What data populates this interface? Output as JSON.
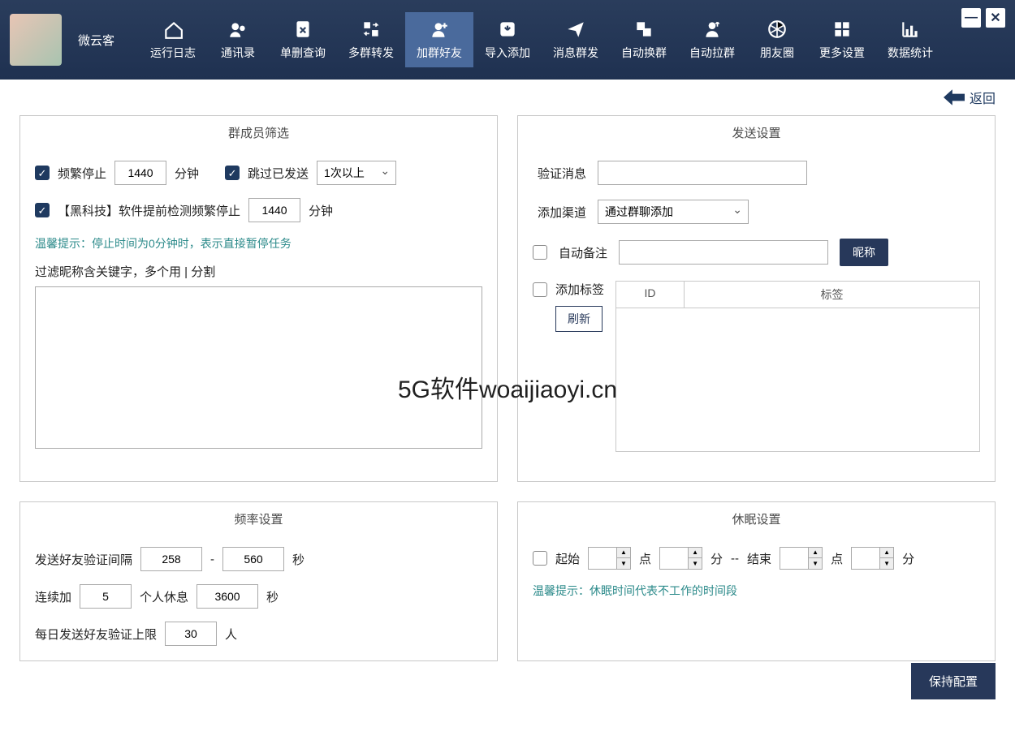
{
  "app_title": "微云客",
  "nav": [
    {
      "label": "运行日志",
      "icon": "home"
    },
    {
      "label": "通讯录",
      "icon": "contacts"
    },
    {
      "label": "单删查询",
      "icon": "doc-x"
    },
    {
      "label": "多群转发",
      "icon": "swap"
    },
    {
      "label": "加群好友",
      "icon": "user-plus",
      "active": true
    },
    {
      "label": "导入添加",
      "icon": "import"
    },
    {
      "label": "消息群发",
      "icon": "send"
    },
    {
      "label": "自动换群",
      "icon": "layers"
    },
    {
      "label": "自动拉群",
      "icon": "person-up"
    },
    {
      "label": "朋友圈",
      "icon": "aperture"
    },
    {
      "label": "更多设置",
      "icon": "grid"
    },
    {
      "label": "数据统计",
      "icon": "chart"
    }
  ],
  "back_label": "返回",
  "panels": {
    "filter": {
      "title": "群成员筛选",
      "freq_stop_label": "频繁停止",
      "freq_stop_value": "1440",
      "freq_stop_unit": "分钟",
      "skip_sent_label": "跳过已发送",
      "skip_sent_select": "1次以上",
      "black_tech_label": "【黑科技】软件提前检测频繁停止",
      "black_tech_value": "1440",
      "black_tech_unit": "分钟",
      "hint_prefix": "温馨提示：",
      "hint_text": "停止时间为0分钟时，表示直接暂停任务",
      "filter_kw_label": "过滤昵称含关键字，多个用 | 分割"
    },
    "send": {
      "title": "发送设置",
      "verify_msg_label": "验证消息",
      "add_channel_label": "添加渠道",
      "add_channel_value": "通过群聊添加",
      "auto_remark_label": "自动备注",
      "nickname_btn": "昵称",
      "add_tag_label": "添加标签",
      "refresh_btn": "刷新",
      "th_id": "ID",
      "th_tag": "标签"
    },
    "freq": {
      "title": "频率设置",
      "interval_label": "发送好友验证间隔",
      "interval_min": "258",
      "interval_sep": "-",
      "interval_max": "560",
      "interval_unit": "秒",
      "continuous_label": "连续加",
      "continuous_value": "5",
      "rest_label": "个人休息",
      "rest_value": "3600",
      "rest_unit": "秒",
      "daily_limit_label": "每日发送好友验证上限",
      "daily_limit_value": "30",
      "daily_limit_unit": "人"
    },
    "sleep": {
      "title": "休眠设置",
      "start_label": "起始",
      "hour_unit": "点",
      "min_unit": "分",
      "sep": "--",
      "end_label": "结束",
      "hint_prefix": "温馨提示：",
      "hint_text": "休眠时间代表不工作的时间段"
    }
  },
  "save_label": "保持配置",
  "watermark": "5G软件woaijiaoyi.cn"
}
